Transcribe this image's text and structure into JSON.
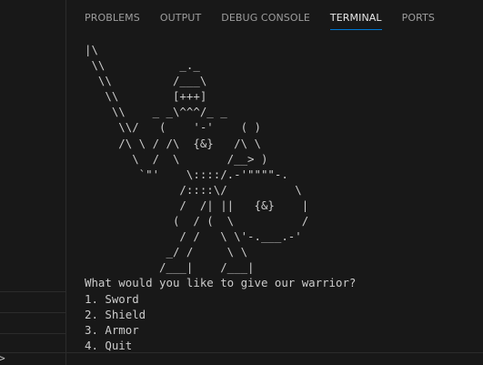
{
  "panel_tabs": {
    "problems": "PROBLEMS",
    "output": "OUTPUT",
    "debug_console": "DEBUG CONSOLE",
    "terminal": "TERMINAL",
    "ports": "PORTS"
  },
  "active_tab": "TERMINAL",
  "terminal": {
    "ascii_art": [
      "|\\",
      " \\\\           _._",
      "  \\\\         /___\\",
      "   \\\\        [+++]",
      "    \\\\    _ _\\^^^/_ _",
      "     \\\\/   (    '-'    ( )",
      "     /\\ \\ / /\\  {&}   /\\ \\",
      "       \\  /  \\       /__> )",
      "        `\"'    \\::::/.-'\"\"\"\"-.",
      "              /::::\\/          \\",
      "              /  /| ||   {&}    |",
      "             (  / (  \\          /",
      "              / /   \\ \\'-.___.-'",
      "            _/ /     \\ \\",
      "           /___|    /___|"
    ],
    "prompt": "What would you like to give our warrior?",
    "options": [
      "1. Sword",
      "2. Shield",
      "3. Armor",
      "4. Quit"
    ]
  },
  "bottom_left_glyph": ">"
}
